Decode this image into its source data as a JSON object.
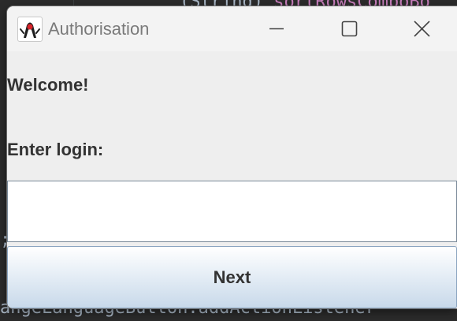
{
  "background_code": {
    "top_plain": "(String) ",
    "top_highlight": "sortRowsComboBo",
    "left_fragment": ";",
    "bottom_line": "angeLanguageButton.addActionListener"
  },
  "window": {
    "title": "Authorisation",
    "icon": "java-duke-icon",
    "controls": {
      "minimize_icon": "minimize-icon",
      "maximize_icon": "maximize-icon",
      "close_icon": "close-icon"
    }
  },
  "form": {
    "welcome_text": "Welcome!",
    "login_label": "Enter login:",
    "login_value": "",
    "next_label": "Next"
  },
  "colors": {
    "editor_bg": "#2b2b2b",
    "window_bg": "#eeeeee",
    "titlebar_bg": "#f3f3f3",
    "highlight_purple": "#c77dbb"
  }
}
